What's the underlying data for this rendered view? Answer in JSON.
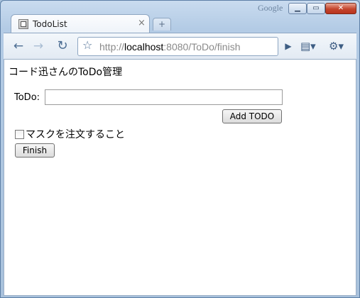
{
  "window": {
    "brand": "Google",
    "controls": {
      "minimize": "▁",
      "maximize": "▭",
      "close": "✕"
    }
  },
  "tab": {
    "title": "TodoList",
    "close": "×",
    "new_tab": "+"
  },
  "toolbar": {
    "back": "←",
    "forward": "→",
    "reload": "↻",
    "star": "☆",
    "go": "▶",
    "page_menu": "▤▾",
    "tools_menu": "⚙▾"
  },
  "address": {
    "scheme": "http://",
    "host": "localhost",
    "rest": ":8080/ToDo/finish"
  },
  "page": {
    "heading": "コード迅さんのToDo管理",
    "todo_label": "ToDo:",
    "todo_value": "",
    "add_button": "Add TODO",
    "item_label": "マスクを注文すること",
    "item_checked": false,
    "finish_button": "Finish"
  },
  "colors": {
    "frame": "#a9c2dc",
    "close_button": "#c4452d",
    "page_bg": "#ffffff"
  }
}
